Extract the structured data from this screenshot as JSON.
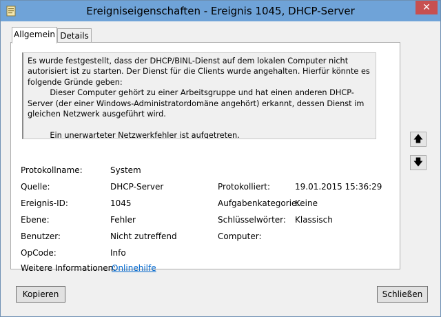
{
  "window": {
    "title": "Ereigniseigenschaften - Ereignis 1045, DHCP-Server",
    "close": "✕"
  },
  "tabs": [
    {
      "label": "Allgemein"
    },
    {
      "label": "Details"
    }
  ],
  "description": "Es wurde festgestellt, dass der DHCP/BINL-Dienst auf dem lokalen Computer nicht autorisiert ist zu starten. Der Dienst für die Clients wurde angehalten. Hierfür könnte es folgende Gründe geben:\n\t Dieser Computer gehört zu einer Arbeitsgruppe und hat einen anderen DHCP-Server (der einer Windows-Administratordomäne angehört) erkannt, dessen Dienst im gleichen Netzwerk ausgeführt wird.\n\n\t Ein unerwarteter Netzwerkfehler ist aufgetreten.",
  "fields": {
    "protokollname": {
      "label": "Protokollname:",
      "value": "System"
    },
    "quelle": {
      "label": "Quelle:",
      "value": "DHCP-Server"
    },
    "ereignis_id": {
      "label": "Ereignis-ID:",
      "value": "1045"
    },
    "ebene": {
      "label": "Ebene:",
      "value": "Fehler"
    },
    "benutzer": {
      "label": "Benutzer:",
      "value": "Nicht zutreffend"
    },
    "opcode": {
      "label": "OpCode:",
      "value": "Info"
    },
    "weitere": {
      "label": "Weitere Informationen:",
      "link": "Onlinehilfe"
    },
    "protokolliert": {
      "label": "Protokolliert:",
      "value": "19.01.2015 15:36:29"
    },
    "aufgabenkategorie": {
      "label": "Aufgabenkategorie:",
      "value": "Keine"
    },
    "schluesselwoerter": {
      "label": "Schlüsselwörter:",
      "value": "Klassisch"
    },
    "computer": {
      "label": "Computer:"
    }
  },
  "nav": {
    "up": "🡅",
    "down": "🡇"
  },
  "buttons": {
    "copy": "Kopieren",
    "close": "Schließen"
  }
}
